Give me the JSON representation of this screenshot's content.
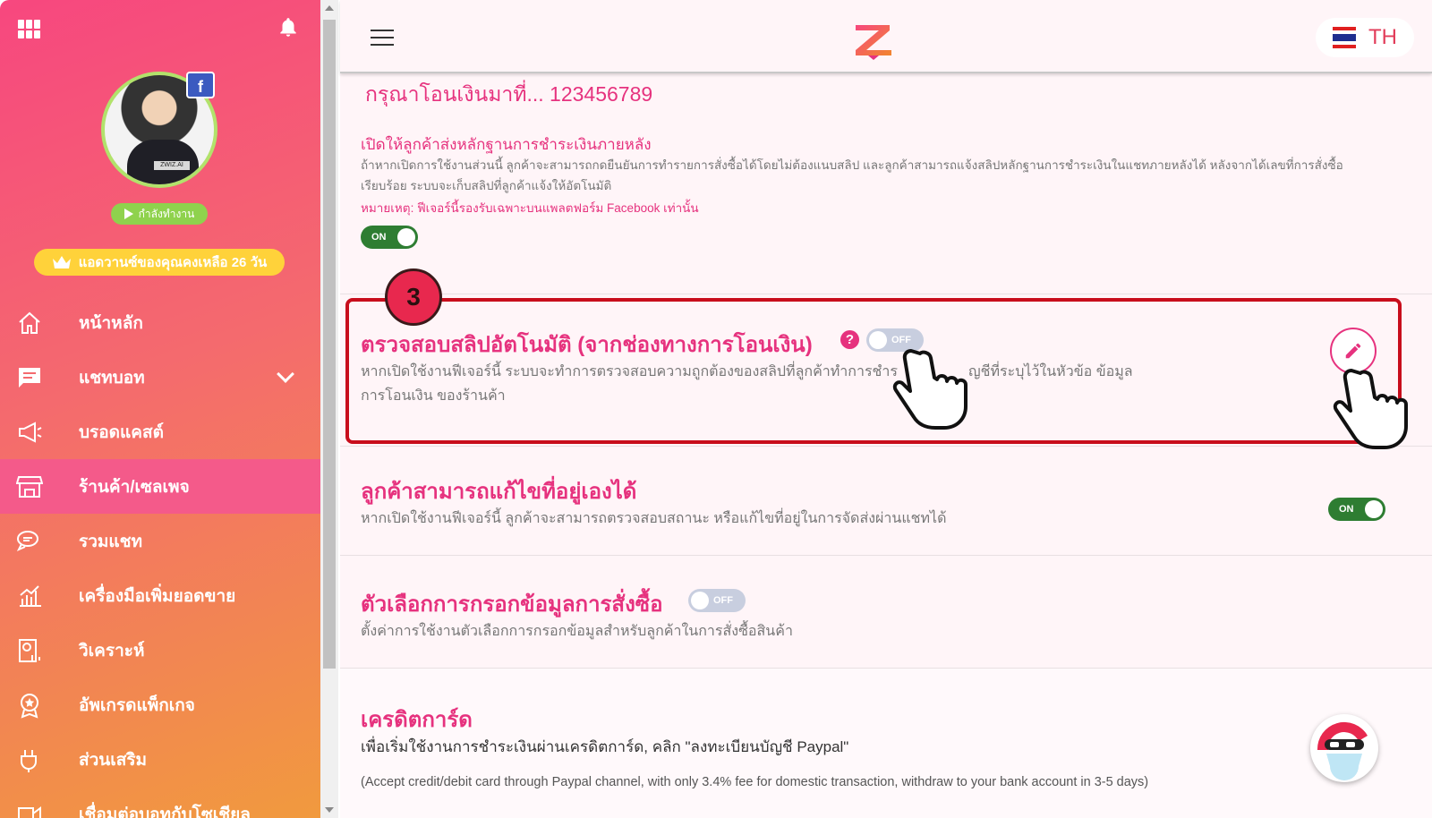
{
  "sidebar": {
    "status_label": "กำลังทำงาน",
    "trial_label": "แอดวานซ์ของคุณคงเหลือ 26 วัน",
    "items": [
      {
        "label": "หน้าหลัก",
        "icon": "home-icon"
      },
      {
        "label": "แชทบอท",
        "icon": "chat-icon",
        "has_chevron": true
      },
      {
        "label": "บรอดแคสต์",
        "icon": "megaphone-icon"
      },
      {
        "label": "ร้านค้า/เซลเพจ",
        "icon": "store-icon",
        "active": true
      },
      {
        "label": "รวมแชท",
        "icon": "chats-icon"
      },
      {
        "label": "เครื่องมือเพิ่มยอดขาย",
        "icon": "chart-icon"
      },
      {
        "label": "วิเคราะห์",
        "icon": "analytics-icon"
      },
      {
        "label": "อัพเกรดแพ็กเกจ",
        "icon": "badge-icon"
      },
      {
        "label": "ส่วนเสริม",
        "icon": "plugin-icon"
      },
      {
        "label": "เชื่อมต่อบอทกับโซเชียล",
        "icon": "connect-icon"
      }
    ]
  },
  "header": {
    "lang": "TH"
  },
  "transfer": {
    "notice": "กรุณาโอนเงินมาที่... 123456789"
  },
  "slip_later": {
    "title": "เปิดให้ลูกค้าส่งหลักฐานการชำระเงินภายหลัง",
    "desc_line1": "ถ้าหากเปิดการใช้งานส่วนนี้ ลูกค้าจะสามารถกดยืนยันการทำรายการสั่งซื้อได้โดยไม่ต้องแนบสลิป และลูกค้าสามารถแจ้งสลิปหลักฐานการชำระเงินในแชทภายหลังได้ หลังจากได้เลขที่การสั่งซื้อ",
    "desc_line2": "เรียบร้อย ระบบจะเก็บสลิปที่ลูกค้าแจ้งให้อัตโนมัติ",
    "note": "หมายเหตุ: ฟีเจอร์นี้รองรับเฉพาะบนแพลตฟอร์ม Facebook เท่านั้น",
    "toggle": "ON"
  },
  "auto_slip": {
    "step": "3",
    "title": "ตรวจสอบสลิปอัตโนมัติ (จากช่องทางการโอนเงิน)",
    "help": "?",
    "toggle": "OFF",
    "desc_line1": "หากเปิดใช้งานฟีเจอร์นี้ ระบบจะทำการตรวจสอบความถูกต้องของสลิปที่ลูกค้าทำการชำร",
    "desc_line1b": "ญชีที่ระบุไว้ในหัวข้อ ข้อมูล",
    "desc_line2": "การโอนเงิน ของร้านค้า"
  },
  "edit_address": {
    "title": "ลูกค้าสามารถแก้ไขที่อยู่เองได้",
    "desc": "หากเปิดใช้งานฟีเจอร์นี้ ลูกค้าจะสามารถตรวจสอบสถานะ หรือแก้ไขที่อยู่ในการจัดส่งผ่านแชทได้",
    "toggle": "ON"
  },
  "order_options": {
    "title": "ตัวเลือกการกรอกข้อมูลการสั่งซื้อ",
    "desc": "ตั้งค่าการใช้งานตัวเลือกการกรอกข้อมูลสำหรับลูกค้าในการสั่งซื้อสินค้า",
    "toggle": "OFF"
  },
  "credit_card": {
    "title": "เครดิตการ์ด",
    "desc": "เพื่อเริ่มใช้งานการชำระเงินผ่านเครดิตการ์ด, คลิก \"ลงทะเบียนบัญชี Paypal\"",
    "note": "(Accept credit/debit card through Paypal channel, with only 3.4% fee for domestic transaction, withdraw to your bank account in 3-5 days)"
  },
  "colors": {
    "accent": "#e6327e",
    "highlight": "#c80d1c",
    "toggle_on": "#2e7d32",
    "toggle_off": "#c8cedf"
  }
}
